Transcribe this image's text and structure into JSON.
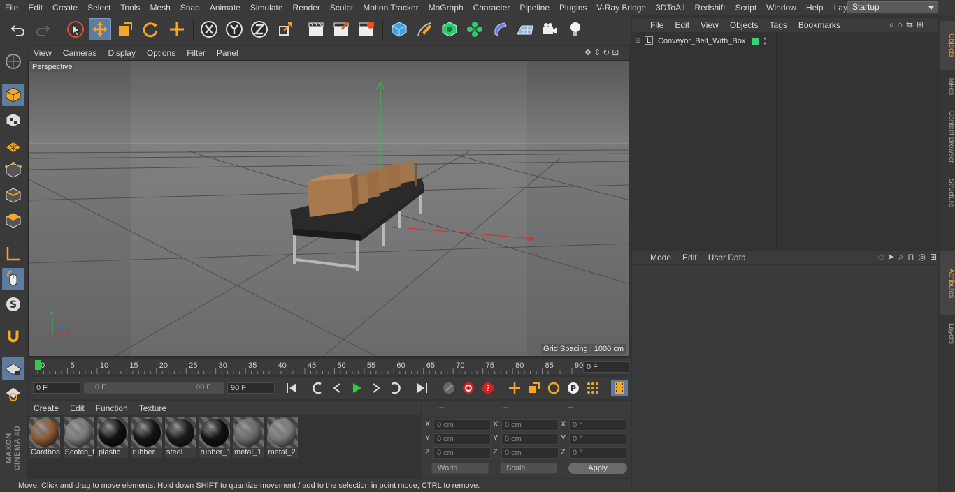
{
  "menubar": {
    "items": [
      "File",
      "Edit",
      "Create",
      "Select",
      "Tools",
      "Mesh",
      "Snap",
      "Animate",
      "Simulate",
      "Render",
      "Sculpt",
      "Motion Tracker",
      "MoGraph",
      "Character",
      "Pipeline",
      "Plugins",
      "V-Ray Bridge",
      "3DToAll",
      "Redshift",
      "Script",
      "Window",
      "Help"
    ],
    "layout_label": "Layout:",
    "layout_value": "Startup"
  },
  "viewport": {
    "menu": [
      "View",
      "Cameras",
      "Display",
      "Options",
      "Filter",
      "Panel"
    ],
    "label": "Perspective",
    "grid_spacing": "Grid Spacing : 1000 cm",
    "axis_x": "X",
    "axis_y": "Y",
    "axis_z": "Z"
  },
  "timeline": {
    "ticks": [
      "0",
      "5",
      "10",
      "15",
      "20",
      "25",
      "30",
      "35",
      "40",
      "45",
      "50",
      "55",
      "60",
      "65",
      "70",
      "75",
      "80",
      "85",
      "90"
    ],
    "current_frame": "0 F",
    "start_field": "0 F",
    "range_start": "0 F",
    "range_end": "90 F",
    "end_field": "90 F"
  },
  "materials": {
    "menu": [
      "Create",
      "Edit",
      "Function",
      "Texture"
    ],
    "items": [
      {
        "name": "Cardboard",
        "color": "#8a5a36"
      },
      {
        "name": "Scotch_tape",
        "color": "#7a7a7a"
      },
      {
        "name": "plastic",
        "color": "#111111"
      },
      {
        "name": "rubber",
        "color": "#141414"
      },
      {
        "name": "steel",
        "color": "#1c1c1c"
      },
      {
        "name": "rubber_1",
        "color": "#121212"
      },
      {
        "name": "metal_1",
        "color": "#6a6a6a"
      },
      {
        "name": "metal_2",
        "color": "#7a7a7a"
      }
    ]
  },
  "coords": {
    "headers": [
      "--",
      "--",
      "--"
    ],
    "rows": [
      {
        "a": "X",
        "av": "0 cm",
        "b": "X",
        "bv": "0 cm",
        "c": "X",
        "cv": "0 °"
      },
      {
        "a": "Y",
        "av": "0 cm",
        "b": "Y",
        "bv": "0 cm",
        "c": "Y",
        "cv": "0 °"
      },
      {
        "a": "Z",
        "av": "0 cm",
        "b": "Z",
        "bv": "0 cm",
        "c": "Z",
        "cv": "0 °"
      }
    ],
    "mode_world": "World",
    "mode_scale": "Scale",
    "apply": "Apply"
  },
  "status": "Move: Click and drag to move elements. Hold down SHIFT to quantize movement / add to the selection in point mode, CTRL to remove.",
  "objects": {
    "menu": [
      "File",
      "Edit",
      "View",
      "Objects",
      "Tags",
      "Bookmarks"
    ],
    "tree": [
      {
        "name": "Conveyor_Belt_With_Box",
        "tag_color": "#3fd07a"
      }
    ]
  },
  "attributes": {
    "menu": [
      "Mode",
      "Edit",
      "User Data"
    ]
  },
  "right_tabs": [
    "Objects",
    "Takes",
    "Content Browser",
    "Structure",
    "Attributes",
    "Layers"
  ],
  "brand": "MAXON CINEMA 4D",
  "colors": {
    "accent": "#5d7c9f",
    "axis_y": "#33c24a",
    "axis_x": "#d32f2f",
    "axis_z": "#3f5fd0",
    "play": "#2ecc40"
  }
}
